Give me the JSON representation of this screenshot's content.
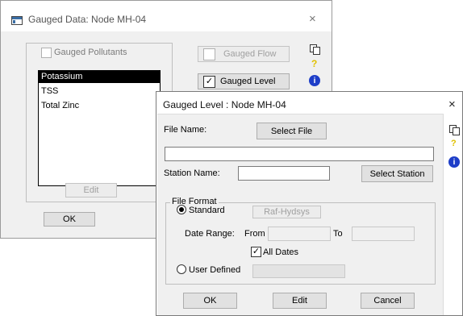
{
  "main_window": {
    "title": "Gauged Data: Node MH-04",
    "close": "×",
    "gauged_pollutants_label": "Gauged Pollutants",
    "gauged_flow_label": "Gauged Flow",
    "gauged_level_label": "Gauged Level",
    "gauged_level_check": "✓",
    "pollutants": [
      "Potassium",
      "TSS",
      "Total Zinc"
    ],
    "edit_label": "Edit",
    "ok_label": "OK",
    "side_icons": {
      "copy": "copy-icon",
      "help": "?",
      "info": "i"
    }
  },
  "level_dialog": {
    "title": "Gauged Level : Node MH-04",
    "close": "×",
    "file_name_label": "File Name:",
    "select_file_label": "Select File",
    "file_path_value": "",
    "station_name_label": "Station Name:",
    "station_name_value": "",
    "select_station_label": "Select Station",
    "file_format_label": "File Format",
    "standard_label": "Standard",
    "raf_hydsys_label": "Raf-Hydsys",
    "date_range_label": "Date Range:",
    "from_label": "From",
    "from_value": "",
    "to_label": "To",
    "to_value": "",
    "all_dates_label": "All Dates",
    "all_dates_check": "✓",
    "user_defined_label": "User Defined",
    "user_defined_value": "",
    "ok_label": "OK",
    "edit_label": "Edit",
    "cancel_label": "Cancel",
    "side_icons": {
      "copy": "copy-icon",
      "help": "?",
      "info": "i"
    }
  }
}
